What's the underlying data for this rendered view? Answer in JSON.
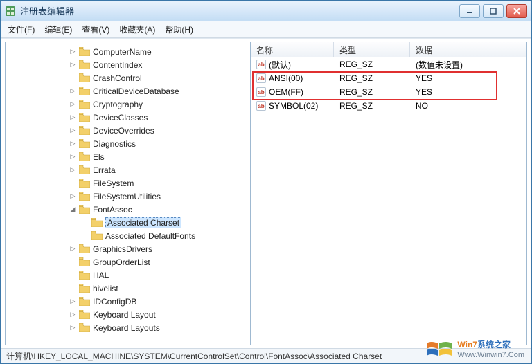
{
  "window": {
    "title": "注册表编辑器"
  },
  "menu": {
    "file": "文件(F)",
    "edit": "编辑(E)",
    "view": "查看(V)",
    "favorites": "收藏夹(A)",
    "help": "帮助(H)"
  },
  "tree": {
    "items": [
      {
        "label": "ComputerName",
        "depth": 5,
        "toggle": "▷"
      },
      {
        "label": "ContentIndex",
        "depth": 5,
        "toggle": "▷"
      },
      {
        "label": "CrashControl",
        "depth": 5,
        "toggle": ""
      },
      {
        "label": "CriticalDeviceDatabase",
        "depth": 5,
        "toggle": "▷"
      },
      {
        "label": "Cryptography",
        "depth": 5,
        "toggle": "▷"
      },
      {
        "label": "DeviceClasses",
        "depth": 5,
        "toggle": "▷"
      },
      {
        "label": "DeviceOverrides",
        "depth": 5,
        "toggle": "▷"
      },
      {
        "label": "Diagnostics",
        "depth": 5,
        "toggle": "▷"
      },
      {
        "label": "Els",
        "depth": 5,
        "toggle": "▷"
      },
      {
        "label": "Errata",
        "depth": 5,
        "toggle": "▷"
      },
      {
        "label": "FileSystem",
        "depth": 5,
        "toggle": ""
      },
      {
        "label": "FileSystemUtilities",
        "depth": 5,
        "toggle": "▷"
      },
      {
        "label": "FontAssoc",
        "depth": 5,
        "toggle": "◢"
      },
      {
        "label": "Associated Charset",
        "depth": 6,
        "toggle": "",
        "selected": true
      },
      {
        "label": "Associated DefaultFonts",
        "depth": 6,
        "toggle": ""
      },
      {
        "label": "GraphicsDrivers",
        "depth": 5,
        "toggle": "▷"
      },
      {
        "label": "GroupOrderList",
        "depth": 5,
        "toggle": ""
      },
      {
        "label": "HAL",
        "depth": 5,
        "toggle": ""
      },
      {
        "label": "hivelist",
        "depth": 5,
        "toggle": ""
      },
      {
        "label": "IDConfigDB",
        "depth": 5,
        "toggle": "▷"
      },
      {
        "label": "Keyboard Layout",
        "depth": 5,
        "toggle": "▷"
      },
      {
        "label": "Keyboard Layouts",
        "depth": 5,
        "toggle": "▷"
      }
    ]
  },
  "grid": {
    "headers": {
      "name": "名称",
      "type": "类型",
      "data": "数据"
    },
    "rows": [
      {
        "name": "(默认)",
        "type": "REG_SZ",
        "data": "(数值未设置)"
      },
      {
        "name": "ANSI(00)",
        "type": "REG_SZ",
        "data": "YES"
      },
      {
        "name": "OEM(FF)",
        "type": "REG_SZ",
        "data": "YES"
      },
      {
        "name": "SYMBOL(02)",
        "type": "REG_SZ",
        "data": "NO"
      }
    ]
  },
  "statusbar": {
    "path": "计算机\\HKEY_LOCAL_MACHINE\\SYSTEM\\CurrentControlSet\\Control\\FontAssoc\\Associated Charset"
  },
  "watermark": {
    "brand_a": "Win7",
    "brand_b": "系统之家",
    "url": "Www.Winwin7.Com"
  }
}
